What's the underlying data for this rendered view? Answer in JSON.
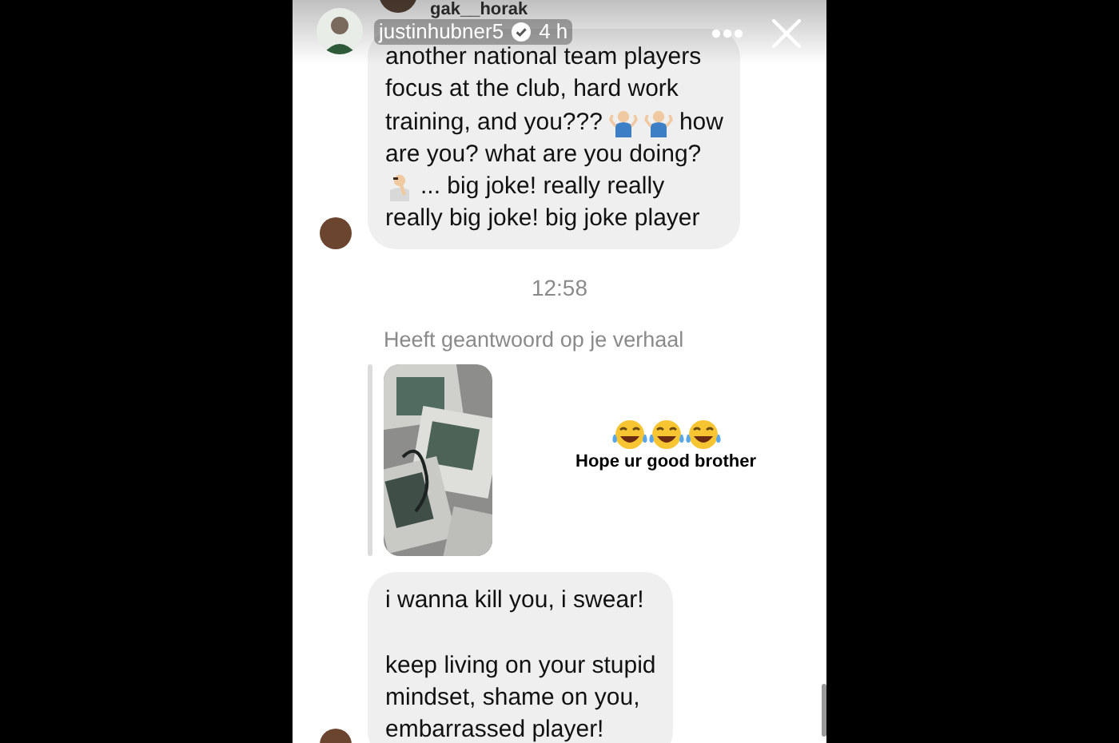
{
  "story_header": {
    "partial_name": "gak__horak",
    "username": "justinhubner5",
    "verified": true,
    "time": "4 h"
  },
  "messages": [
    {
      "kind": "bubble",
      "lines": [
        {
          "kind": "text",
          "parts": [
            {
              "kind": "text",
              "text": "another national team players"
            }
          ]
        },
        {
          "kind": "text",
          "parts": [
            {
              "kind": "text",
              "text": "focus at the club, hard work"
            }
          ]
        },
        {
          "kind": "text",
          "parts": [
            {
              "kind": "text",
              "text": "training, and you???"
            },
            {
              "kind": "shrug"
            },
            {
              "kind": "shrug"
            },
            {
              "kind": "text",
              "text": "how"
            }
          ]
        },
        {
          "kind": "text",
          "parts": [
            {
              "kind": "text",
              "text": "are you? what are you doing?"
            }
          ]
        },
        {
          "kind": "text",
          "parts": [
            {
              "kind": "facepalm"
            },
            {
              "kind": "text",
              "text": "... big joke! really really"
            }
          ]
        },
        {
          "kind": "text",
          "parts": [
            {
              "kind": "text",
              "text": "really big joke! big joke player"
            }
          ]
        }
      ]
    },
    {
      "kind": "timestamp",
      "text": "12:58"
    },
    {
      "kind": "story_reply",
      "label": "Heeft geantwoord op je verhaal",
      "sticker": "Hope ur good brother"
    },
    {
      "kind": "bubble",
      "lines": [
        {
          "kind": "text",
          "parts": [
            {
              "kind": "text",
              "text": "i wanna kill you, i swear!"
            }
          ]
        },
        {
          "kind": "spacer"
        },
        {
          "kind": "text",
          "parts": [
            {
              "kind": "text",
              "text": "keep living on your stupid"
            }
          ]
        },
        {
          "kind": "text",
          "parts": [
            {
              "kind": "text",
              "text": "mindset, shame on you,"
            }
          ]
        },
        {
          "kind": "text",
          "parts": [
            {
              "kind": "text",
              "text": "embarrassed player!"
            }
          ]
        }
      ]
    }
  ]
}
